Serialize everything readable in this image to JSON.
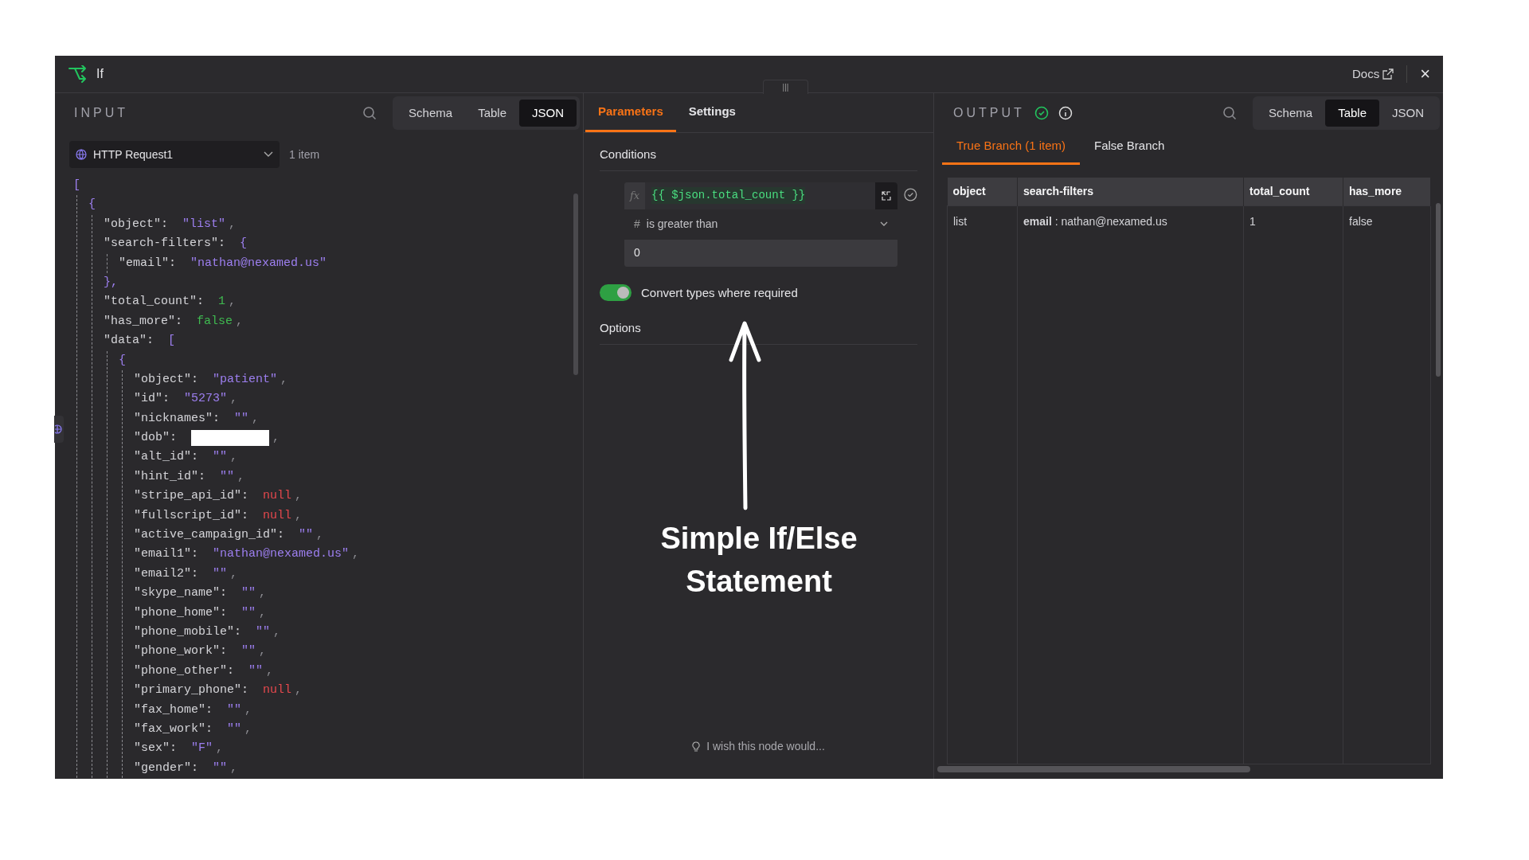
{
  "window": {
    "title": "If",
    "docs_link": "Docs",
    "close": "×",
    "drag_handle": "|||"
  },
  "input": {
    "heading": "INPUT",
    "view_tabs": [
      {
        "label": "Schema",
        "selected": false
      },
      {
        "label": "Table",
        "selected": false
      },
      {
        "label": "JSON",
        "selected": true
      }
    ],
    "source": "HTTP Request1",
    "item_count": "1 item",
    "json_tree": [
      {
        "open": "[",
        "children": [
          {
            "open": "{",
            "children": [
              {
                "key": "\"object\":",
                "value": "\"list\"",
                "kind": "string",
                "comma": ","
              },
              {
                "key": "\"search-filters\":",
                "open": "{",
                "children": [
                  {
                    "key": "\"email\":",
                    "value": "\"nathan@nexamed.us\"",
                    "kind": "string"
                  }
                ],
                "close": "},"
              },
              {
                "key": "\"total_count\":",
                "value": "1",
                "kind": "number",
                "comma": ","
              },
              {
                "key": "\"has_more\":",
                "value": "false",
                "kind": "boolean",
                "comma": ","
              },
              {
                "key": "\"data\":",
                "open": "[",
                "children": [
                  {
                    "open": "{",
                    "children": [
                      {
                        "key": "\"object\":",
                        "value": "\"patient\"",
                        "kind": "string",
                        "comma": ","
                      },
                      {
                        "key": "\"id\":",
                        "value": "\"5273\"",
                        "kind": "string",
                        "comma": ","
                      },
                      {
                        "key": "\"nicknames\":",
                        "value": "\"\"",
                        "kind": "string",
                        "comma": ","
                      },
                      {
                        "key": "\"dob\":",
                        "kind": "redacted",
                        "comma": ","
                      },
                      {
                        "key": "\"alt_id\":",
                        "value": "\"\"",
                        "kind": "string",
                        "comma": ","
                      },
                      {
                        "key": "\"hint_id\":",
                        "value": "\"\"",
                        "kind": "string",
                        "comma": ","
                      },
                      {
                        "key": "\"stripe_api_id\":",
                        "value": "null",
                        "kind": "null",
                        "comma": ","
                      },
                      {
                        "key": "\"fullscript_id\":",
                        "value": "null",
                        "kind": "null",
                        "comma": ","
                      },
                      {
                        "key": "\"active_campaign_id\":",
                        "value": "\"\"",
                        "kind": "string",
                        "comma": ","
                      },
                      {
                        "key": "\"email1\":",
                        "value": "\"nathan@nexamed.us\"",
                        "kind": "string",
                        "comma": ","
                      },
                      {
                        "key": "\"email2\":",
                        "value": "\"\"",
                        "kind": "string",
                        "comma": ","
                      },
                      {
                        "key": "\"skype_name\":",
                        "value": "\"\"",
                        "kind": "string",
                        "comma": ","
                      },
                      {
                        "key": "\"phone_home\":",
                        "value": "\"\"",
                        "kind": "string",
                        "comma": ","
                      },
                      {
                        "key": "\"phone_mobile\":",
                        "value": "\"\"",
                        "kind": "string",
                        "comma": ","
                      },
                      {
                        "key": "\"phone_work\":",
                        "value": "\"\"",
                        "kind": "string",
                        "comma": ","
                      },
                      {
                        "key": "\"phone_other\":",
                        "value": "\"\"",
                        "kind": "string",
                        "comma": ","
                      },
                      {
                        "key": "\"primary_phone\":",
                        "value": "null",
                        "kind": "null",
                        "comma": ","
                      },
                      {
                        "key": "\"fax_home\":",
                        "value": "\"\"",
                        "kind": "string",
                        "comma": ","
                      },
                      {
                        "key": "\"fax_work\":",
                        "value": "\"\"",
                        "kind": "string",
                        "comma": ","
                      },
                      {
                        "key": "\"sex\":",
                        "value": "\"F\"",
                        "kind": "string",
                        "comma": ","
                      },
                      {
                        "key": "\"gender\":",
                        "value": "\"\"",
                        "kind": "string",
                        "comma": ","
                      }
                    ]
                  }
                ]
              }
            ]
          }
        ]
      }
    ]
  },
  "parameters": {
    "tabs": [
      {
        "label": "Parameters",
        "selected": true
      },
      {
        "label": "Settings",
        "selected": false
      }
    ],
    "conditions_title": "Conditions",
    "condition": {
      "fx_label": "fx",
      "left_value": "{{ $json.total_count }}",
      "operator_symbol": "#",
      "operator": "is greater than",
      "right_value": "0"
    },
    "convert_types": {
      "label": "Convert types where required",
      "on": true
    },
    "options_title": "Options",
    "feedback": "I wish this node would..."
  },
  "annotation": {
    "lines": [
      "Simple If/Else",
      "Statement"
    ]
  },
  "output": {
    "heading": "OUTPUT",
    "view_tabs": [
      {
        "label": "Schema",
        "selected": false
      },
      {
        "label": "Table",
        "selected": true
      },
      {
        "label": "JSON",
        "selected": false
      }
    ],
    "branch_tabs": [
      {
        "label": "True Branch (1 item)",
        "selected": true
      },
      {
        "label": "False Branch",
        "selected": false
      }
    ],
    "table": {
      "columns": [
        "object",
        "search-filters",
        "total_count",
        "has_more"
      ],
      "rows": [
        {
          "cells": [
            "list",
            "**email** : nathan@nexamed.us",
            "1",
            "false"
          ]
        }
      ]
    }
  }
}
